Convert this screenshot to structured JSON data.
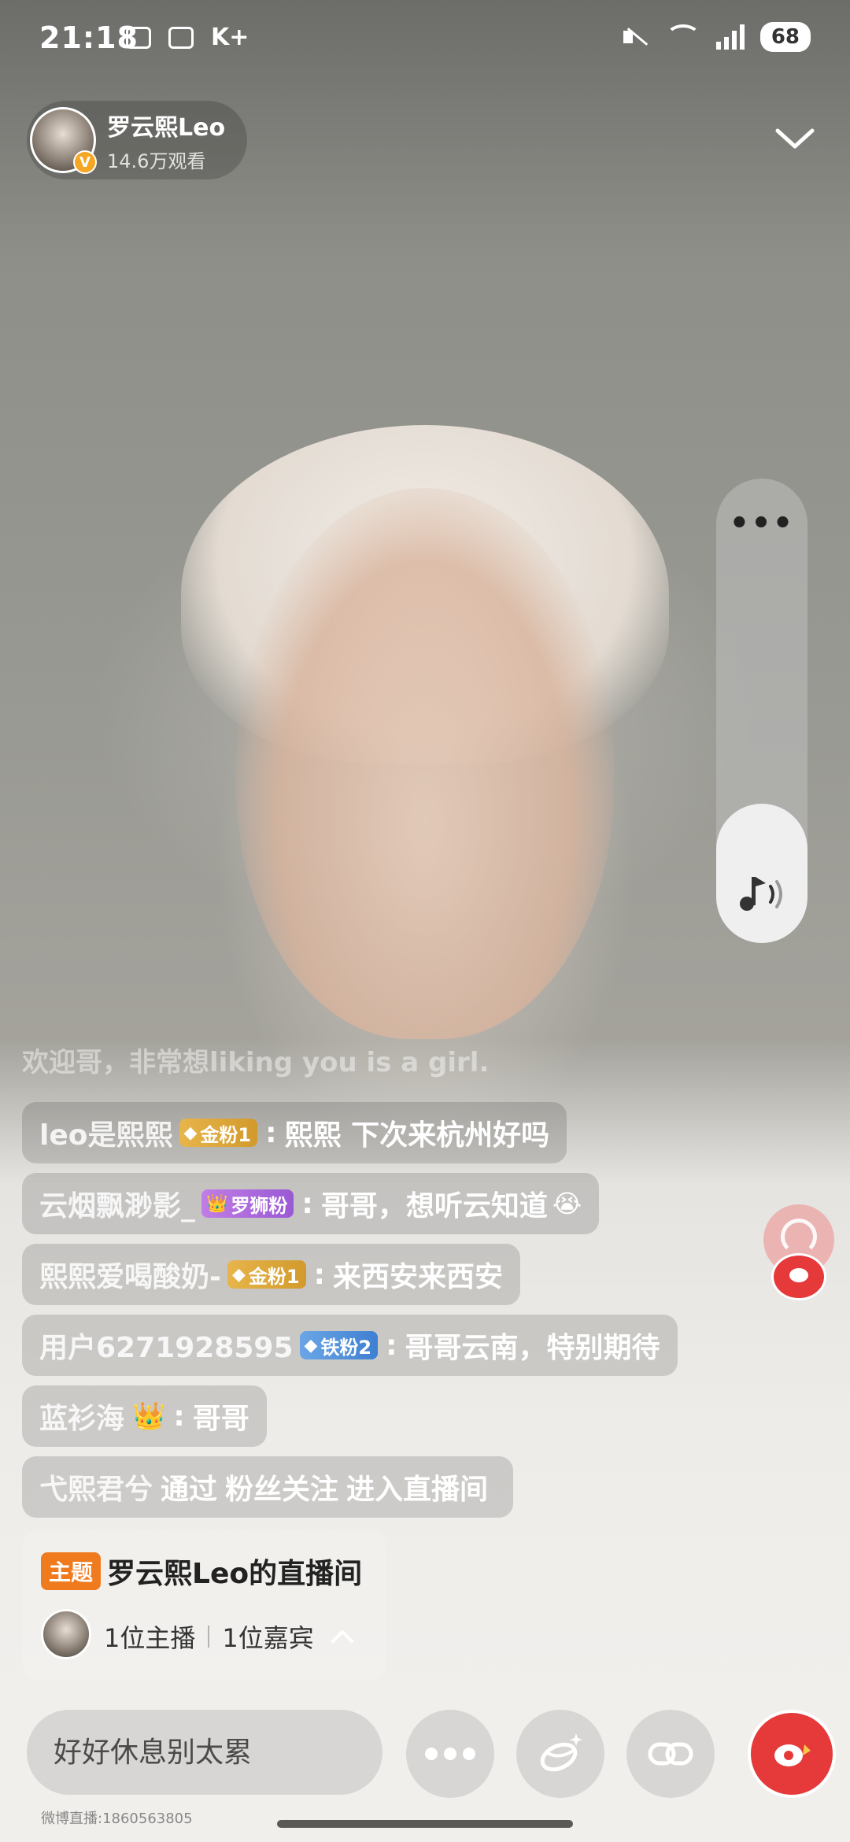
{
  "status_bar": {
    "time": "21:18",
    "carrier": "K+",
    "battery": "68"
  },
  "host": {
    "name": "罗云熙Leo",
    "viewers": "14.6万观看",
    "verified_mark": "V"
  },
  "chat": {
    "faded_line": "欢迎哥，非常想liking you is a girl.",
    "messages": [
      {
        "user": "leo是熙熙",
        "badge": {
          "label": "金粉1",
          "style": "gold",
          "icon": "◆"
        },
        "text": "熙熙 下次来杭州好吗",
        "emoji": ""
      },
      {
        "user": "云烟飘渺影_",
        "badge": {
          "label": "罗狮粉",
          "style": "purple",
          "icon": "👑"
        },
        "text": "哥哥，想听云知道",
        "emoji": "😭"
      },
      {
        "user": "熙熙爱喝酸奶-",
        "badge": {
          "label": "金粉1",
          "style": "gold",
          "icon": "◆"
        },
        "text": "来西安来西安",
        "emoji": ""
      },
      {
        "user": "用户6271928595",
        "badge": {
          "label": "铁粉2",
          "style": "iron",
          "icon": "◆"
        },
        "text": "哥哥云南，特别期待",
        "emoji": ""
      },
      {
        "user": "蓝衫海",
        "crown": "👑",
        "text": "哥哥"
      }
    ],
    "join": {
      "user": "弋熙君兮",
      "via": "通过",
      "source": "粉丝关注",
      "action": "进入直播间"
    }
  },
  "topic": {
    "tag": "主题",
    "title": "罗云熙Leo的直播间",
    "hosts": "1位主播",
    "guests": "1位嘉宾"
  },
  "volume": {
    "level_percent": 30
  },
  "bottom": {
    "comment_placeholder": "好好休息别太累"
  },
  "watermark": "微博直播:1860563805",
  "icons": [
    "collapse-chevron-icon",
    "more-icon",
    "music-volume-icon",
    "share-icon",
    "link-icon",
    "gift-icon"
  ]
}
